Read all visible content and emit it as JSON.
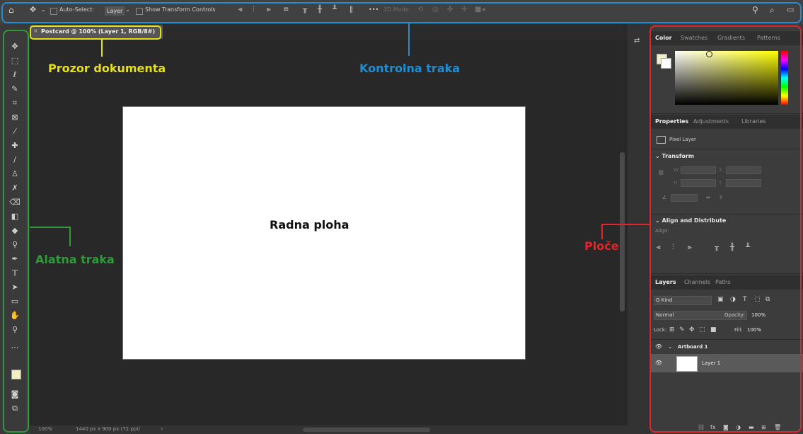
{
  "optionbar": {
    "auto_select_label": "Auto-Select:",
    "auto_select_value": "Layer",
    "show_transform_label": "Show Transform Controls",
    "mode_3d_label": "3D Mode:",
    "more_label": "•••"
  },
  "document": {
    "tab_title": "Postcard @ 100% (Layer 1, RGB/8#)",
    "zoom": "100%",
    "dimensions": "1440 px x 900 px (72 ppi)"
  },
  "color_panel": {
    "tabs": [
      "Color",
      "Swatches",
      "Gradients",
      "Patterns"
    ]
  },
  "properties_panel": {
    "tabs": [
      "Properties",
      "Adjustments",
      "Libraries"
    ],
    "layer_type": "Pixel Layer",
    "transform_label": "Transform",
    "align_distribute_label": "Align and Distribute",
    "align_label": "Align:",
    "w_label": "W",
    "h_label": "H",
    "x_label": "X",
    "y_label": "Y"
  },
  "layers_panel": {
    "tabs": [
      "Layers",
      "Channels",
      "Paths"
    ],
    "filter_label": "Q Kind",
    "blend_mode": "Normal",
    "opacity_label": "Opacity:",
    "opacity_value": "100%",
    "lock_label": "Lock:",
    "fill_label": "Fill:",
    "fill_value": "100%",
    "layers": [
      {
        "name": "Artboard 1"
      },
      {
        "name": "Layer 1"
      }
    ]
  },
  "annotations": {
    "document_window": "Prozor dokumenta",
    "control_bar": "Kontrolna traka",
    "toolbar": "Alatna traka",
    "artboard": "Radna ploha",
    "panels": "Ploče"
  },
  "colors": {
    "document_window": "#e4e01a",
    "control_bar": "#1e8fd4",
    "toolbar": "#2e9a3a",
    "panels": "#e0262a",
    "foreground_swatch": "#f2efc2"
  },
  "icons": {
    "home": "home-icon",
    "move": "move-icon",
    "search": "search-icon",
    "zoom": "zoom-icon"
  }
}
